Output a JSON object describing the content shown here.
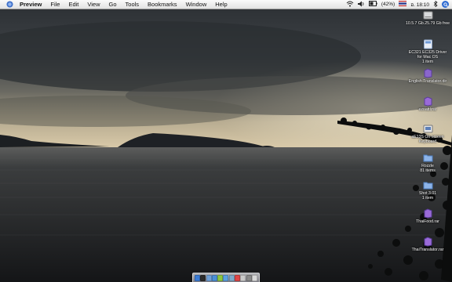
{
  "menubar": {
    "app_name": "Preview",
    "items": [
      "File",
      "Edit",
      "View",
      "Go",
      "Tools",
      "Bookmarks",
      "Window",
      "Help"
    ],
    "battery": "(42%)",
    "clock": "อ. 18:10"
  },
  "desktop_icons": [
    {
      "name": "hd-icon",
      "lines": [
        "10.5.7 Gb.25.79 Gb free"
      ]
    },
    {
      "name": "driver-disk-icon",
      "lines": [
        "EC321 EC325 Driver",
        "for Mac OS",
        "1 item"
      ]
    },
    {
      "name": "english-translator-icon",
      "lines": [
        "English Translator.dir"
      ]
    },
    {
      "name": "rar-archive-icon",
      "lines": [
        "ezoattl.rar"
      ]
    },
    {
      "name": "onscreen-keyboard-icon",
      "lines": [
        "aE13S On-screen",
        "Keyboard"
      ]
    },
    {
      "name": "rozzle-folder-icon",
      "lines": [
        "Rozzle",
        "81 items"
      ]
    },
    {
      "name": "shot-folder-icon",
      "lines": [
        "Shot 3.01",
        "1 item"
      ]
    },
    {
      "name": "thaifood-rar-icon",
      "lines": [
        "ThaiFood.rar"
      ]
    },
    {
      "name": "thai-translator-rar-icon",
      "lines": [
        "ThaiTranslator.rar"
      ]
    }
  ],
  "dock_items": [
    {
      "name": "finder-icon",
      "color": "#3a7bd5"
    },
    {
      "name": "dashboard-icon",
      "color": "#2b2b2b"
    },
    {
      "name": "mail-icon",
      "color": "#6fa0d8"
    },
    {
      "name": "safari-icon",
      "color": "#4b8fd6"
    },
    {
      "name": "ichat-icon",
      "color": "#8cc63f"
    },
    {
      "name": "itunes-icon",
      "color": "#5aa0e0"
    },
    {
      "name": "iphoto-icon",
      "color": "#7fa9c9"
    },
    {
      "name": "ical-icon",
      "color": "#e04646"
    },
    {
      "name": "preview-icon",
      "color": "#c9c9c9"
    },
    {
      "name": "system-preferences-icon",
      "color": "#8a8a8a"
    },
    {
      "name": "trash-icon",
      "color": "#d8d8d8"
    }
  ]
}
